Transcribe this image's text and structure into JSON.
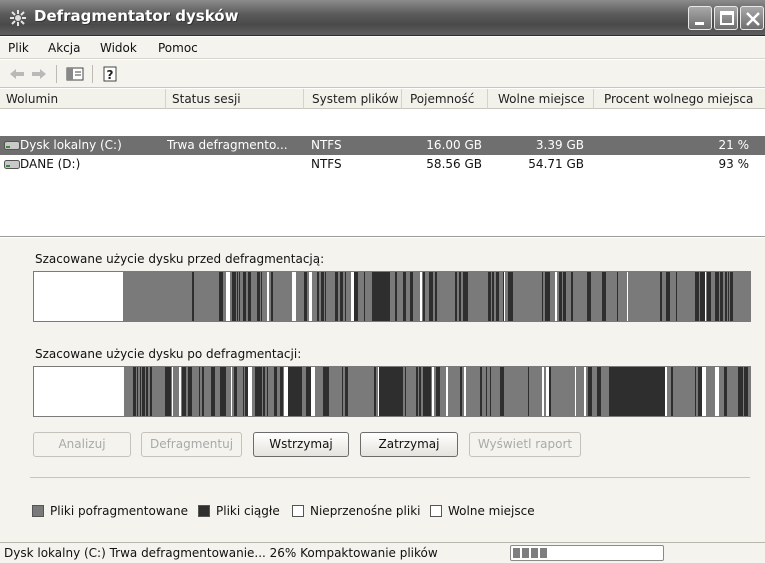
{
  "window": {
    "title": "Defragmentator dysków",
    "title_icon": "defrag-app-icon"
  },
  "menu": {
    "items": [
      "Plik",
      "Akcja",
      "Widok",
      "Pomoc"
    ]
  },
  "toolbar": {
    "icons": [
      "back-arrow-icon",
      "forward-arrow-icon",
      "show-hide-pane-icon",
      "help-icon"
    ]
  },
  "volumes": {
    "columns": [
      "Wolumin",
      "Status sesji",
      "System plików",
      "Pojemność",
      "Wolne miejsce",
      "Procent wolnego miejsca"
    ],
    "rows": [
      {
        "name": "Dysk lokalny (C:)",
        "status": "Trwa defragmento...",
        "fs": "NTFS",
        "capacity": "16.00 GB",
        "free": "3.39 GB",
        "percent": "21 %",
        "selected": true
      },
      {
        "name": "DANE (D:)",
        "status": "",
        "fs": "NTFS",
        "capacity": "58.56 GB",
        "free": "54.71 GB",
        "percent": "93 %",
        "selected": false
      }
    ]
  },
  "analysis": {
    "before_label": "Szacowane użycie dysku przed defragmentacją:",
    "after_label": "Szacowane użycie dysku po defragmentacji:"
  },
  "buttons": {
    "analyze": "Analizuj",
    "defragment": "Defragmentuj",
    "pause": "Wstrzymaj",
    "stop": "Zatrzymaj",
    "report": "Wyświetl raport"
  },
  "legend": {
    "fragmented": "Pliki pofragmentowane",
    "contiguous": "Pliki ciągłe",
    "unmovable": "Nieprzenośne pliki",
    "free": "Wolne miejsce"
  },
  "colors": {
    "fragmented": "#7a7a7a",
    "contiguous": "#2e2e2e",
    "unmovable": "#ffffff",
    "free": "#ffffff",
    "selection": "#6f6f6f"
  },
  "status": {
    "text": "Dysk lokalny (C:) Trwa defragmentowanie... 26%  Kompaktowanie plików",
    "progress": 0.26
  }
}
